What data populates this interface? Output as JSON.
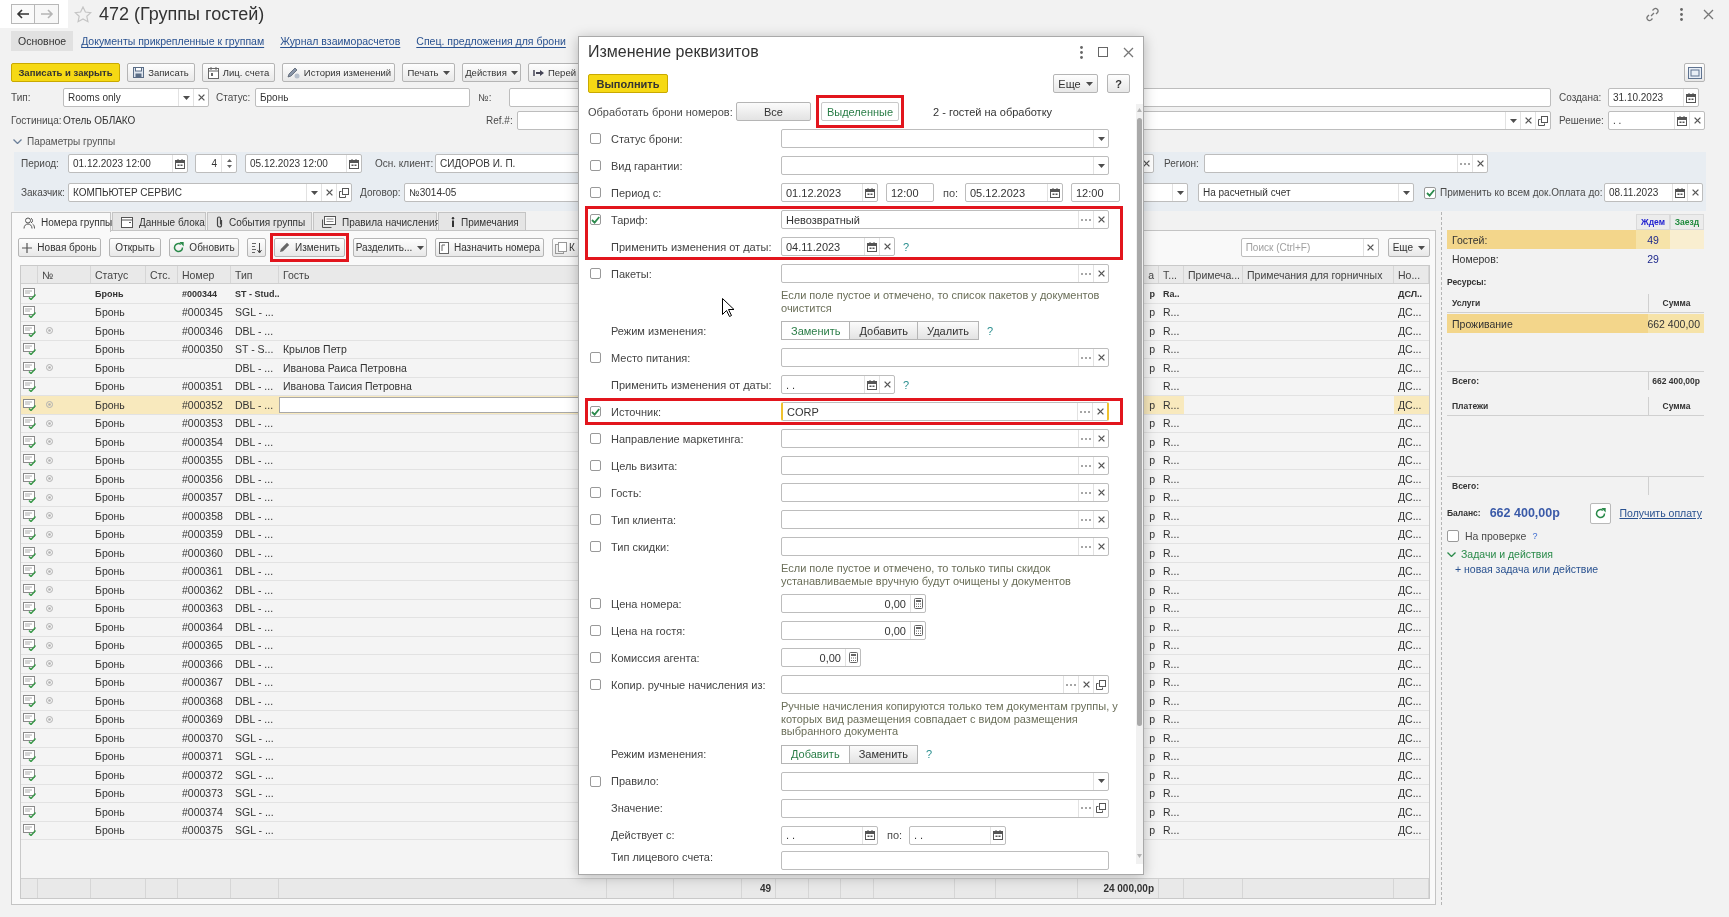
{
  "window": {
    "title": "472 (Группы гостей)"
  },
  "navigation": {
    "back": {
      "disabled": false
    },
    "forward": {
      "disabled": true
    }
  },
  "form_tabs": [
    {
      "label": "Основное",
      "selected": true
    },
    {
      "label": "Документы прикрепленные к группам",
      "selected": false
    },
    {
      "label": "Журнал взаиморасчетов",
      "selected": false
    },
    {
      "label": "Спец. предложения для брони",
      "selected": false
    }
  ],
  "command_bar": [
    {
      "kind": "primary",
      "label": "Записать и закрыть"
    },
    {
      "kind": "save",
      "label": "Записать"
    },
    {
      "kind": "accounts",
      "label": "Лиц. счета"
    },
    {
      "kind": "history",
      "label": "История изменений"
    },
    {
      "kind": "menu",
      "label": "Печать"
    },
    {
      "kind": "menu",
      "label": "Действия"
    },
    {
      "kind": "goto",
      "label": "Перей"
    },
    {
      "kind": "view"
    }
  ],
  "fields": {
    "type": {
      "label": "Тип:",
      "value": "Rooms only"
    },
    "status": {
      "label": "Статус:",
      "value": "Бронь"
    },
    "number": {
      "label": "№:"
    },
    "created": {
      "label": "Создана:",
      "value": "31.10.2023"
    },
    "hotel": {
      "label": "Гостиница:",
      "value": "Отель ОБЛАКО"
    },
    "ref": {
      "label": "Ref.#:"
    },
    "decision": {
      "label": "Решение:",
      "value": ". ."
    }
  },
  "group_params": {
    "title": "Параметры группы",
    "expanded": true,
    "period": {
      "label": "Период:",
      "from": "01.12.2023 12:00",
      "nights": "4",
      "to": "05.12.2023 12:00"
    },
    "main_client": {
      "label": "Осн. клиент:",
      "value": "СИДОРОВ И. П."
    },
    "region": {
      "label": "Регион:"
    },
    "customer": {
      "label": "Заказчик:",
      "value": "КОМПЬЮТЕР СЕРВИС"
    },
    "contract": {
      "label": "Договор:",
      "value": "№3014-05"
    },
    "payment_method": {
      "value": "На расчетный счет"
    },
    "apply_to_all": {
      "label": "Применить ко всем док.",
      "checked": true
    },
    "pay_until": {
      "label": "Оплата до:",
      "value": "08.11.2023"
    }
  },
  "tabs": [
    {
      "kind": "rooms",
      "label": "Номера группы",
      "selected": true
    },
    {
      "kind": "block",
      "label": "Данные блока",
      "selected": false
    },
    {
      "kind": "events",
      "label": "События группы",
      "selected": false
    },
    {
      "kind": "rules",
      "label": "Правила начисления",
      "selected": false
    },
    {
      "kind": "notes",
      "label": "Примечания",
      "selected": false
    }
  ],
  "toolbar": {
    "buttons": [
      {
        "kind": "add",
        "label": "Новая бронь",
        "highlighted": false
      },
      {
        "kind": "plain",
        "label": "Открыть",
        "highlighted": false
      },
      {
        "kind": "refresh",
        "label": "Обновить",
        "highlighted": false
      },
      {
        "kind": "sort",
        "highlighted": false
      },
      {
        "kind": "edit",
        "label": "Изменить",
        "highlighted": true
      },
      {
        "kind": "menu",
        "label": "Разделить...",
        "highlighted": false
      },
      {
        "kind": "assign",
        "label": "Назначить номера",
        "highlighted": false
      },
      {
        "kind": "copy",
        "label": "К",
        "highlighted": false
      }
    ],
    "search": {
      "placeholder": "Поиск (Ctrl+F)"
    },
    "more": "Еще"
  },
  "table": {
    "columns": [
      "№",
      "Статус",
      "Стс.",
      "Номер",
      "Тип",
      "Гость",
      "а",
      "Т...",
      "Примеча...",
      "Примечания для горничных",
      "Но..."
    ],
    "rows": [
      {
        "kind": "main",
        "selected": false,
        "marked": false,
        "status": "Бронь",
        "number": "#000344",
        "type": "ST - Stud..",
        "column_6": "р",
        "column_7": "Ra..",
        "column_10": "ДСЛ.."
      },
      {
        "kind": "member",
        "selected": false,
        "marked": false,
        "status": "Бронь",
        "number": "#000345",
        "type": "SGL - ...",
        "column_6": "р",
        "column_7": "R...",
        "column_10": "ДС..."
      },
      {
        "kind": "member",
        "selected": false,
        "marked": true,
        "status": "Бронь",
        "number": "#000346",
        "type": "DBL - ...",
        "column_6": "р",
        "column_7": "R...",
        "column_10": "ДС..."
      },
      {
        "kind": "member",
        "selected": false,
        "marked": false,
        "status": "Бронь",
        "number": "#000350",
        "type": "ST - S...",
        "guest": "Крылов Петр",
        "column_6": "р",
        "column_7": "R...",
        "column_10": "ДС..."
      },
      {
        "kind": "member",
        "selected": false,
        "marked": true,
        "status": "Бронь",
        "type": "DBL - ...",
        "guest": "Иванова Раиса Петровна",
        "column_6": "р",
        "column_7": "R...",
        "column_10": "ДС..."
      },
      {
        "kind": "member",
        "selected": false,
        "marked": false,
        "status": "Бронь",
        "number": "#000351",
        "type": "DBL - ...",
        "guest": "Иванова Таисия Петровна",
        "column_7": "R...",
        "column_10": "ДС..."
      },
      {
        "kind": "member",
        "selected": true,
        "marked": true,
        "status": "Бронь",
        "number": "#000352",
        "type": "DBL - ...",
        "column_6": "р",
        "column_7": "R...",
        "column_10": "ДС..."
      },
      {
        "kind": "member",
        "selected": false,
        "marked": true,
        "status": "Бронь",
        "number": "#000353",
        "type": "DBL - ...",
        "column_6": "р",
        "column_7": "R...",
        "column_10": "ДС..."
      },
      {
        "kind": "member",
        "selected": false,
        "marked": true,
        "status": "Бронь",
        "number": "#000354",
        "type": "DBL - ...",
        "column_6": "р",
        "column_7": "R...",
        "column_10": "ДС..."
      },
      {
        "kind": "member",
        "selected": false,
        "marked": true,
        "status": "Бронь",
        "number": "#000355",
        "type": "DBL - ...",
        "column_6": "р",
        "column_7": "R...",
        "column_10": "ДС..."
      },
      {
        "kind": "member",
        "selected": false,
        "marked": true,
        "status": "Бронь",
        "number": "#000356",
        "type": "DBL - ...",
        "column_6": "р",
        "column_7": "R...",
        "column_10": "ДС..."
      },
      {
        "kind": "member",
        "selected": false,
        "marked": true,
        "status": "Бронь",
        "number": "#000357",
        "type": "DBL - ...",
        "column_6": "р",
        "column_7": "R...",
        "column_10": "ДС..."
      },
      {
        "kind": "member",
        "selected": false,
        "marked": true,
        "status": "Бронь",
        "number": "#000358",
        "type": "DBL - ...",
        "column_6": "р",
        "column_7": "R...",
        "column_10": "ДС..."
      },
      {
        "kind": "member",
        "selected": false,
        "marked": true,
        "status": "Бронь",
        "number": "#000359",
        "type": "DBL - ...",
        "column_6": "р",
        "column_7": "R...",
        "column_10": "ДС..."
      },
      {
        "kind": "member",
        "selected": false,
        "marked": true,
        "status": "Бронь",
        "number": "#000360",
        "type": "DBL - ...",
        "column_6": "р",
        "column_7": "R...",
        "column_10": "ДС..."
      },
      {
        "kind": "member",
        "selected": false,
        "marked": true,
        "status": "Бронь",
        "number": "#000361",
        "type": "DBL - ...",
        "column_6": "р",
        "column_7": "R...",
        "column_10": "ДС..."
      },
      {
        "kind": "member",
        "selected": false,
        "marked": true,
        "status": "Бронь",
        "number": "#000362",
        "type": "DBL - ...",
        "column_6": "р",
        "column_7": "R...",
        "column_10": "ДС..."
      },
      {
        "kind": "member",
        "selected": false,
        "marked": true,
        "status": "Бронь",
        "number": "#000363",
        "type": "DBL - ...",
        "column_6": "р",
        "column_7": "R...",
        "column_10": "ДС..."
      },
      {
        "kind": "member",
        "selected": false,
        "marked": true,
        "status": "Бронь",
        "number": "#000364",
        "type": "DBL - ...",
        "column_6": "р",
        "column_7": "R...",
        "column_10": "ДС..."
      },
      {
        "kind": "member",
        "selected": false,
        "marked": true,
        "status": "Бронь",
        "number": "#000365",
        "type": "DBL - ...",
        "column_6": "р",
        "column_7": "R...",
        "column_10": "ДС..."
      },
      {
        "kind": "member",
        "selected": false,
        "marked": true,
        "status": "Бронь",
        "number": "#000366",
        "type": "DBL - ...",
        "column_6": "р",
        "column_7": "R...",
        "column_10": "ДС..."
      },
      {
        "kind": "member",
        "selected": false,
        "marked": true,
        "status": "Бронь",
        "number": "#000367",
        "type": "DBL - ...",
        "column_6": "р",
        "column_7": "R...",
        "column_10": "ДС..."
      },
      {
        "kind": "member",
        "selected": false,
        "marked": true,
        "status": "Бронь",
        "number": "#000368",
        "type": "DBL - ...",
        "column_6": "р",
        "column_7": "R...",
        "column_10": "ДС..."
      },
      {
        "kind": "member",
        "selected": false,
        "marked": true,
        "status": "Бронь",
        "number": "#000369",
        "type": "DBL - ...",
        "column_6": "р",
        "column_7": "R...",
        "column_10": "ДС..."
      },
      {
        "kind": "member",
        "selected": false,
        "marked": false,
        "status": "Бронь",
        "number": "#000370",
        "type": "SGL - ...",
        "column_6": "р",
        "column_7": "R...",
        "column_10": "ДС..."
      },
      {
        "kind": "member",
        "selected": false,
        "marked": false,
        "status": "Бронь",
        "number": "#000371",
        "type": "SGL - ...",
        "column_6": "р",
        "column_7": "R...",
        "column_10": "ДС..."
      },
      {
        "kind": "member",
        "selected": false,
        "marked": false,
        "status": "Бронь",
        "number": "#000372",
        "type": "SGL - ...",
        "column_6": "р",
        "column_7": "R...",
        "column_10": "ДС..."
      },
      {
        "kind": "member",
        "selected": false,
        "marked": false,
        "status": "Бронь",
        "number": "#000373",
        "type": "SGL - ...",
        "column_6": "р",
        "column_7": "R...",
        "column_10": "ДС..."
      },
      {
        "kind": "member",
        "selected": false,
        "marked": false,
        "status": "Бронь",
        "number": "#000374",
        "type": "SGL - ...",
        "column_6": "р",
        "column_7": "R...",
        "column_10": "ДС..."
      },
      {
        "kind": "member",
        "selected": false,
        "marked": false,
        "status": "Бронь",
        "number": "#000375",
        "type": "SGL - ...",
        "column_6": "р",
        "column_7": "R...",
        "column_10": "ДС..."
      }
    ],
    "footer": [
      "49",
      "24 000,00р"
    ]
  },
  "side_panel": {
    "columns": [
      {
        "label": "Ждем",
        "color": "#1f1fd0"
      },
      {
        "label": "Заезд",
        "color": "#1e8a3c"
      }
    ],
    "rows": [
      {
        "label": "Гостей:",
        "value": "49",
        "selected": true
      },
      {
        "label": "Номеров:",
        "value": "29",
        "selected": false
      }
    ],
    "resources_label": "Ресурсы:",
    "services": {
      "columns": [
        "Услуги",
        "Сумма"
      ],
      "rows": [
        {
          "name": "Проживание",
          "amount": "662 400,00",
          "selected": true
        }
      ],
      "total_label": "Всего:",
      "total": "662 400,00р"
    },
    "payments": {
      "columns": [
        "Платежи",
        "Сумма"
      ],
      "total_label": "Всего:"
    },
    "balance": {
      "label": "Баланс:",
      "value": "662 400,00р"
    },
    "get_payment": "Получить оплату",
    "on_check": {
      "label": "На проверке",
      "checked": false,
      "help": "?"
    },
    "tasks": {
      "title": "Задачи и действия",
      "expanded": true,
      "new_link": "+ новая задача или действие"
    }
  },
  "dialog": {
    "title": "Изменение реквизитов",
    "run_button": "Выполнить",
    "more_button": "Еще",
    "help_button": "?",
    "process": {
      "label": "Обработать брони номеров:",
      "options": [
        {
          "label": "Все",
          "selected": false,
          "highlighted": false
        },
        {
          "label": "Выделенные",
          "selected": true,
          "highlighted": true
        }
      ],
      "info": "2 - гостей на обработку"
    },
    "sections": [
      {
        "highlighted": false,
        "rows": [
          {
            "kind": "select",
            "checked": false,
            "label": "Статус брони:"
          },
          {
            "kind": "select",
            "checked": false,
            "label": "Вид гарантии:"
          },
          {
            "kind": "period",
            "checked": false,
            "label": "Период с:",
            "from_date": "01.12.2023",
            "from_time": "12:00",
            "to_label": "по:",
            "to_date": "05.12.2023",
            "to_time": "12:00"
          }
        ]
      },
      {
        "highlighted": true,
        "rows": [
          {
            "kind": "ref",
            "checked": true,
            "focused": false,
            "label": "Тариф:",
            "value": "Невозвратный"
          },
          {
            "kind": "date",
            "label": "Применить изменения от даты:",
            "value": "04.11.2023",
            "help": "?"
          }
        ]
      },
      {
        "highlighted": false,
        "rows": [
          {
            "kind": "ref",
            "checked": false,
            "focused": false,
            "label": "Пакеты:"
          },
          {
            "kind": "note",
            "text": "Если поле пустое и отмечено, то список пакетов у документов очистится"
          },
          {
            "kind": "mode",
            "label": "Режим изменения:",
            "options": [
              {
                "label": "Заменить",
                "selected": true
              },
              {
                "label": "Добавить",
                "selected": false
              },
              {
                "label": "Удалить",
                "selected": false
              }
            ],
            "help": "?"
          },
          {
            "kind": "ref",
            "checked": false,
            "focused": false,
            "label": "Место питания:"
          },
          {
            "kind": "date",
            "label": "Применить изменения от даты:",
            "value": ". .",
            "help": "?"
          }
        ]
      },
      {
        "highlighted": true,
        "rows": [
          {
            "kind": "ref",
            "checked": true,
            "focused": true,
            "label": "Источник:",
            "value": "CORP"
          }
        ]
      },
      {
        "highlighted": false,
        "rows": [
          {
            "kind": "ref",
            "checked": false,
            "focused": false,
            "label": "Направление маркетинга:"
          },
          {
            "kind": "ref",
            "checked": false,
            "focused": false,
            "label": "Цель визита:"
          },
          {
            "kind": "ref",
            "checked": false,
            "focused": false,
            "label": "Гость:"
          },
          {
            "kind": "ref",
            "checked": false,
            "focused": false,
            "label": "Тип клиента:"
          },
          {
            "kind": "ref",
            "checked": false,
            "focused": false,
            "label": "Тип скидки:"
          },
          {
            "kind": "note",
            "text": "Если поле пустое и отмечено, то только типы скидок устанавливаемые вручную будут очищены у документов"
          },
          {
            "kind": "number",
            "checked": false,
            "label": "Цена номера:",
            "value": "0,00"
          },
          {
            "kind": "number",
            "checked": false,
            "label": "Цена на гостя:",
            "value": "0,00"
          },
          {
            "kind": "number_short",
            "checked": false,
            "label": "Комиссия агента:",
            "value": "0,00"
          },
          {
            "kind": "ref_open",
            "checked": false,
            "label": "Копир. ручные начисления из:"
          },
          {
            "kind": "note",
            "text": "Ручные начисления копируются только тем документам группы, у которых вид размещения совпадает с видом размещения выбранного документа"
          },
          {
            "kind": "mode",
            "label": "Режим изменения:",
            "options": [
              {
                "label": "Добавить",
                "selected": true
              },
              {
                "label": "Заменить",
                "selected": false
              }
            ],
            "help": "?"
          },
          {
            "kind": "select",
            "checked": false,
            "label": "Правило:"
          },
          {
            "kind": "value_open",
            "label": "Значение:"
          },
          {
            "kind": "date_range",
            "label": "Действует с:",
            "from": ". .",
            "to_label": "по:",
            "to": ". ."
          },
          {
            "kind": "text",
            "label": "Тип лицевого счета:"
          }
        ]
      }
    ]
  }
}
